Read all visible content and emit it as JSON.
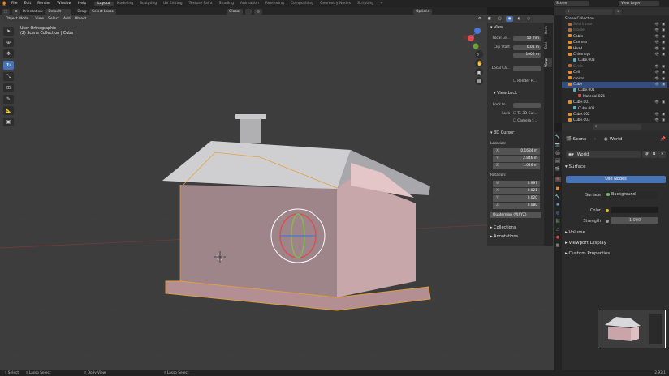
{
  "topmenu": [
    "File",
    "Edit",
    "Render",
    "Window",
    "Help"
  ],
  "workspaces": [
    "Layout",
    "Modeling",
    "Sculpting",
    "UV Editing",
    "Texture Paint",
    "Shading",
    "Animation",
    "Rendering",
    "Compositing",
    "Geometry Nodes",
    "Scripting"
  ],
  "active_workspace": "Layout",
  "scene": {
    "scene_name": "Scene",
    "view_layer": "View Layer"
  },
  "toolbar": {
    "orientation_label": "Orientation:",
    "orientation": "Default",
    "drag_label": "Drag:",
    "drag_value": "Select Lasso",
    "transform": "Global",
    "options": "Options"
  },
  "viewport_header": {
    "mode": "Object Mode",
    "view": "View",
    "select": "Select",
    "add": "Add",
    "object": "Object"
  },
  "viewport_info": {
    "line1": "User Orthographic",
    "line2": "(2) Scene Collection | Cube"
  },
  "npanel": {
    "tabs": [
      "Item",
      "Tool",
      "View"
    ],
    "view": {
      "title": "View",
      "focal_label": "Focal Le...",
      "focal": "50 mm",
      "clip_start_label": "Clip Start",
      "clip_start": "0.01 m",
      "end_label": "End",
      "clip_end": "1000 m",
      "local_camera_label": "Local Ca...",
      "render_region": "Render R..."
    },
    "view_lock": {
      "title": "View Lock",
      "lock_to_label": "Lock to ...",
      "lock_label": "Lock",
      "to_3d_cursor": "To 3D Cur...",
      "camera_to": "Camera t..."
    },
    "cursor": {
      "title": "3D Cursor",
      "location_label": "Location:",
      "x": "0.1684 m",
      "y": "2.846 m",
      "z": "1.026 m",
      "rotation_label": "Rotation:",
      "w": "0.997",
      "rx": "0.021",
      "ry": "0.020",
      "rz": "0.080",
      "mode": "Quaternion (WXYZ)"
    },
    "collections": "Collections",
    "annotations": "Annotations"
  },
  "outliner": {
    "root": "Scene Collection",
    "rows": [
      "Sold frame",
      "Stoolet",
      "Cabin",
      "Camera",
      "Head",
      "Chimneys",
      "Cube.003",
      "Circle",
      "Cell",
      "crosss",
      "Cube",
      "Cube.001",
      "Material.025",
      "Cube.001",
      "Cube.002",
      "Cube.002",
      "Cube.003"
    ]
  },
  "properties": {
    "scene": "Scene",
    "world": "World",
    "world_name": "World",
    "surface_header": "Surface",
    "use_nodes": "Use Nodes",
    "surface_label": "Surface",
    "surface_value": "Background",
    "color_label": "Color",
    "strength_label": "Strength",
    "strength": "1.000",
    "volume": "Volume",
    "viewport_display": "Viewport Display",
    "custom_properties": "Custom Properties"
  },
  "statusbar": {
    "select": "Select",
    "lasso1": "Lasso Select",
    "dolly": "Dolly View",
    "lasso2": "Lasso Select",
    "version": "2.93.1"
  }
}
